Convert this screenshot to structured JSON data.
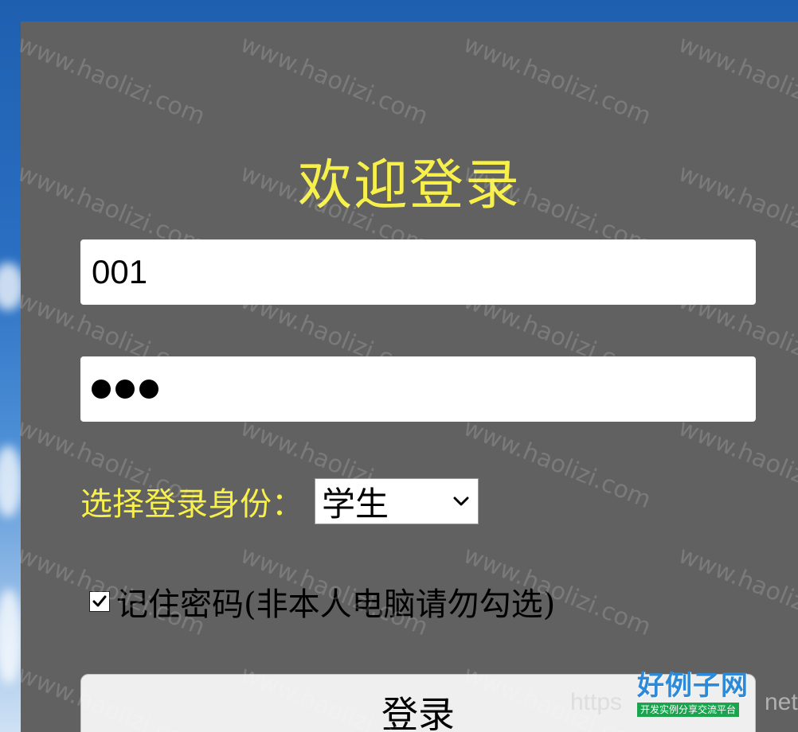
{
  "login": {
    "title": "欢迎登录",
    "username_value": "001",
    "password_mask_count": 3,
    "role_label": "选择登录身份：",
    "role_selected": "学生",
    "remember_checked": true,
    "remember_label": "记住密码(非本人电脑请勿勾选)",
    "submit_label": "登录"
  },
  "watermark": {
    "text": "www.haolizi.com",
    "logo_main": "好例子网",
    "logo_sub": "开发实例分享交流平台",
    "url_fragment": "https",
    "url_tail": "net"
  },
  "colors": {
    "panel_bg": "#616161",
    "accent_yellow": "#f7f04a",
    "button_bg": "#efefef"
  },
  "icons": {
    "select_arrow": "chevron-down-icon",
    "checkbox": "checkmark-icon"
  }
}
